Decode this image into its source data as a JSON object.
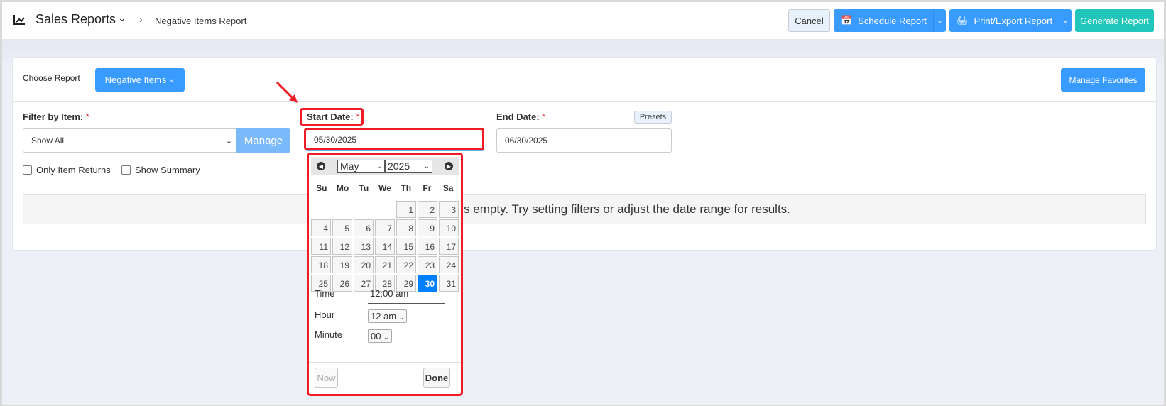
{
  "header": {
    "icon": "line-chart-icon",
    "title": "Sales Reports",
    "breadcrumb": "Negative Items Report",
    "cancel": "Cancel",
    "schedule": "Schedule Report",
    "print": "Print/Export Report",
    "generate": "Generate Report"
  },
  "colors": {
    "primary": "#3a9bff",
    "generate": "#1fc6b9",
    "highlight": "#ee1c24",
    "selected_day": "#007fff"
  },
  "card": {
    "choose_label": "Choose Report",
    "report_button": "Negative Items",
    "manage_favorites": "Manage Favorites",
    "filter_label": "Filter by Item:",
    "filter_value": "Show All",
    "manage": "Manage",
    "start_label": "Start Date:",
    "start_value": "05/30/2025",
    "end_label": "End Date:",
    "end_value": "06/30/2025",
    "presets": "Presets",
    "required": "*",
    "only_returns": "Only Item Returns",
    "show_summary": "Show Summary",
    "empty_message": "s empty. Try setting filters or adjust the date range for results."
  },
  "calendar": {
    "month": "May",
    "year": "2025",
    "dow": [
      "Su",
      "Mo",
      "Tu",
      "We",
      "Th",
      "Fr",
      "Sa"
    ],
    "selected_day": 30,
    "time_label": "Time",
    "time_value": "12:00 am",
    "hour_label": "Hour",
    "hour_value": "12 am",
    "minute_label": "Minute",
    "minute_value": "00",
    "now": "Now",
    "done": "Done"
  }
}
